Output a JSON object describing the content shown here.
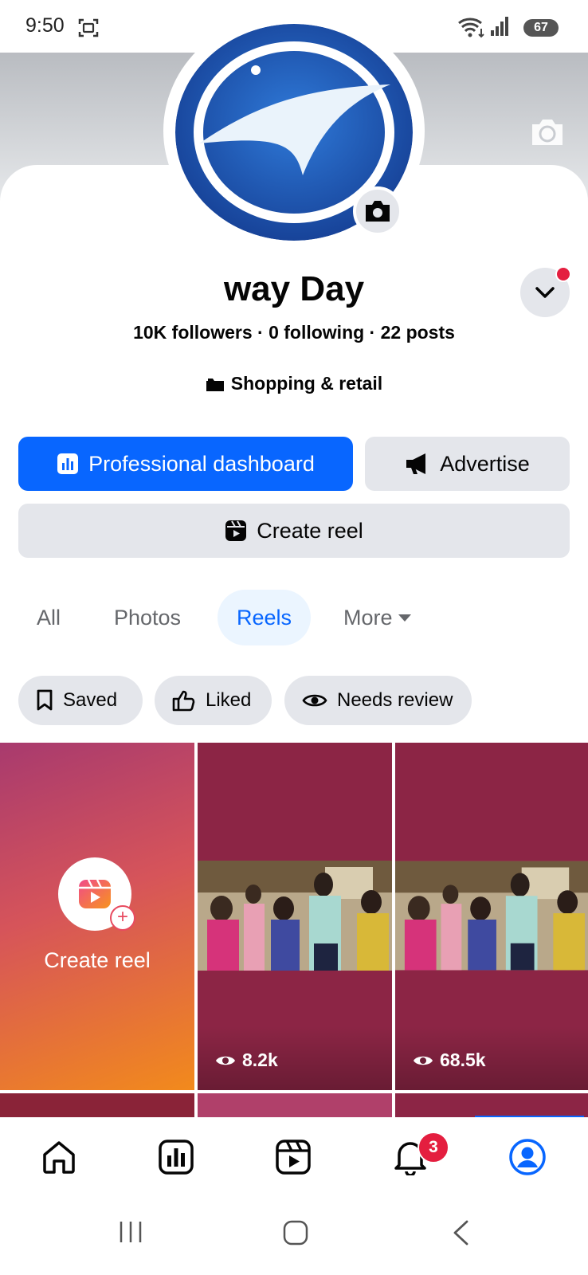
{
  "status_bar": {
    "time": "9:50",
    "battery": "67"
  },
  "profile": {
    "name": "way Day",
    "stats": "10K followers · 0 following · 22 posts",
    "category": "Shopping & retail"
  },
  "actions": {
    "dashboard": "Professional dashboard",
    "advertise": "Advertise",
    "create_reel": "Create reel"
  },
  "tabs": [
    {
      "label": "All"
    },
    {
      "label": "Photos"
    },
    {
      "label": "Reels",
      "active": true
    },
    {
      "label": "More"
    }
  ],
  "filters": [
    {
      "label": "Saved",
      "icon": "bookmark-icon"
    },
    {
      "label": "Liked",
      "icon": "thumbs-up-icon"
    },
    {
      "label": "Needs review",
      "icon": "eye-icon"
    }
  ],
  "grid": {
    "create_label": "Create reel",
    "reels": [
      {
        "views": "8.2k"
      },
      {
        "views": "68.5k"
      }
    ]
  },
  "bottom_nav": {
    "items": [
      "home-icon",
      "dashboard-icon",
      "reels-icon",
      "notifications-icon",
      "profile-icon"
    ],
    "notification_count": "3"
  },
  "colors": {
    "accent": "#0866ff",
    "chip_bg": "#e4e6eb",
    "badge": "#e41e3f"
  }
}
